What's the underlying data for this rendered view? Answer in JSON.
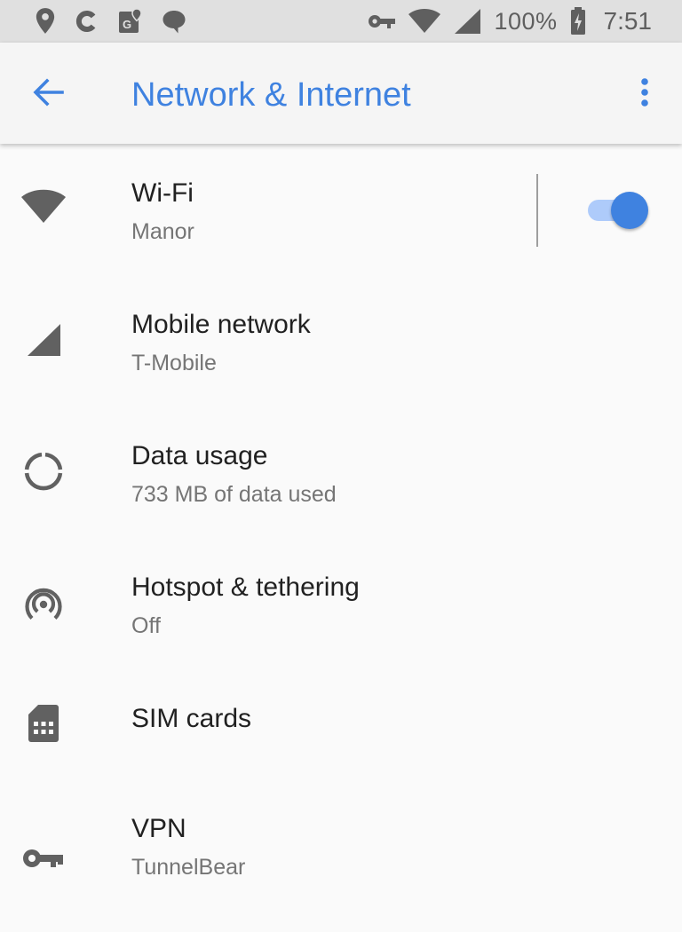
{
  "status_bar": {
    "battery": "100%",
    "time": "7:51",
    "left_icons": [
      "location-pin-icon",
      "c-app-icon",
      "map-g-icon",
      "chat-bubble-icon"
    ],
    "right_icons": [
      "vpn-key-icon",
      "wifi-icon",
      "cell-signal-icon",
      "battery-charging-icon"
    ]
  },
  "app_bar": {
    "title": "Network & Internet",
    "accent_color": "#3f82e0"
  },
  "items": [
    {
      "title": "Wi-Fi",
      "subtitle": "Manor",
      "icon": "wifi-icon",
      "toggle": "on"
    },
    {
      "title": "Mobile network",
      "subtitle": "T-Mobile",
      "icon": "cell-signal-icon"
    },
    {
      "title": "Data usage",
      "subtitle": "733 MB of data used",
      "icon": "data-usage-icon"
    },
    {
      "title": "Hotspot & tethering",
      "subtitle": "Off",
      "icon": "hotspot-icon"
    },
    {
      "title": "SIM cards",
      "subtitle": "",
      "icon": "sim-card-icon"
    },
    {
      "title": "VPN",
      "subtitle": "TunnelBear",
      "icon": "vpn-key-icon"
    }
  ]
}
